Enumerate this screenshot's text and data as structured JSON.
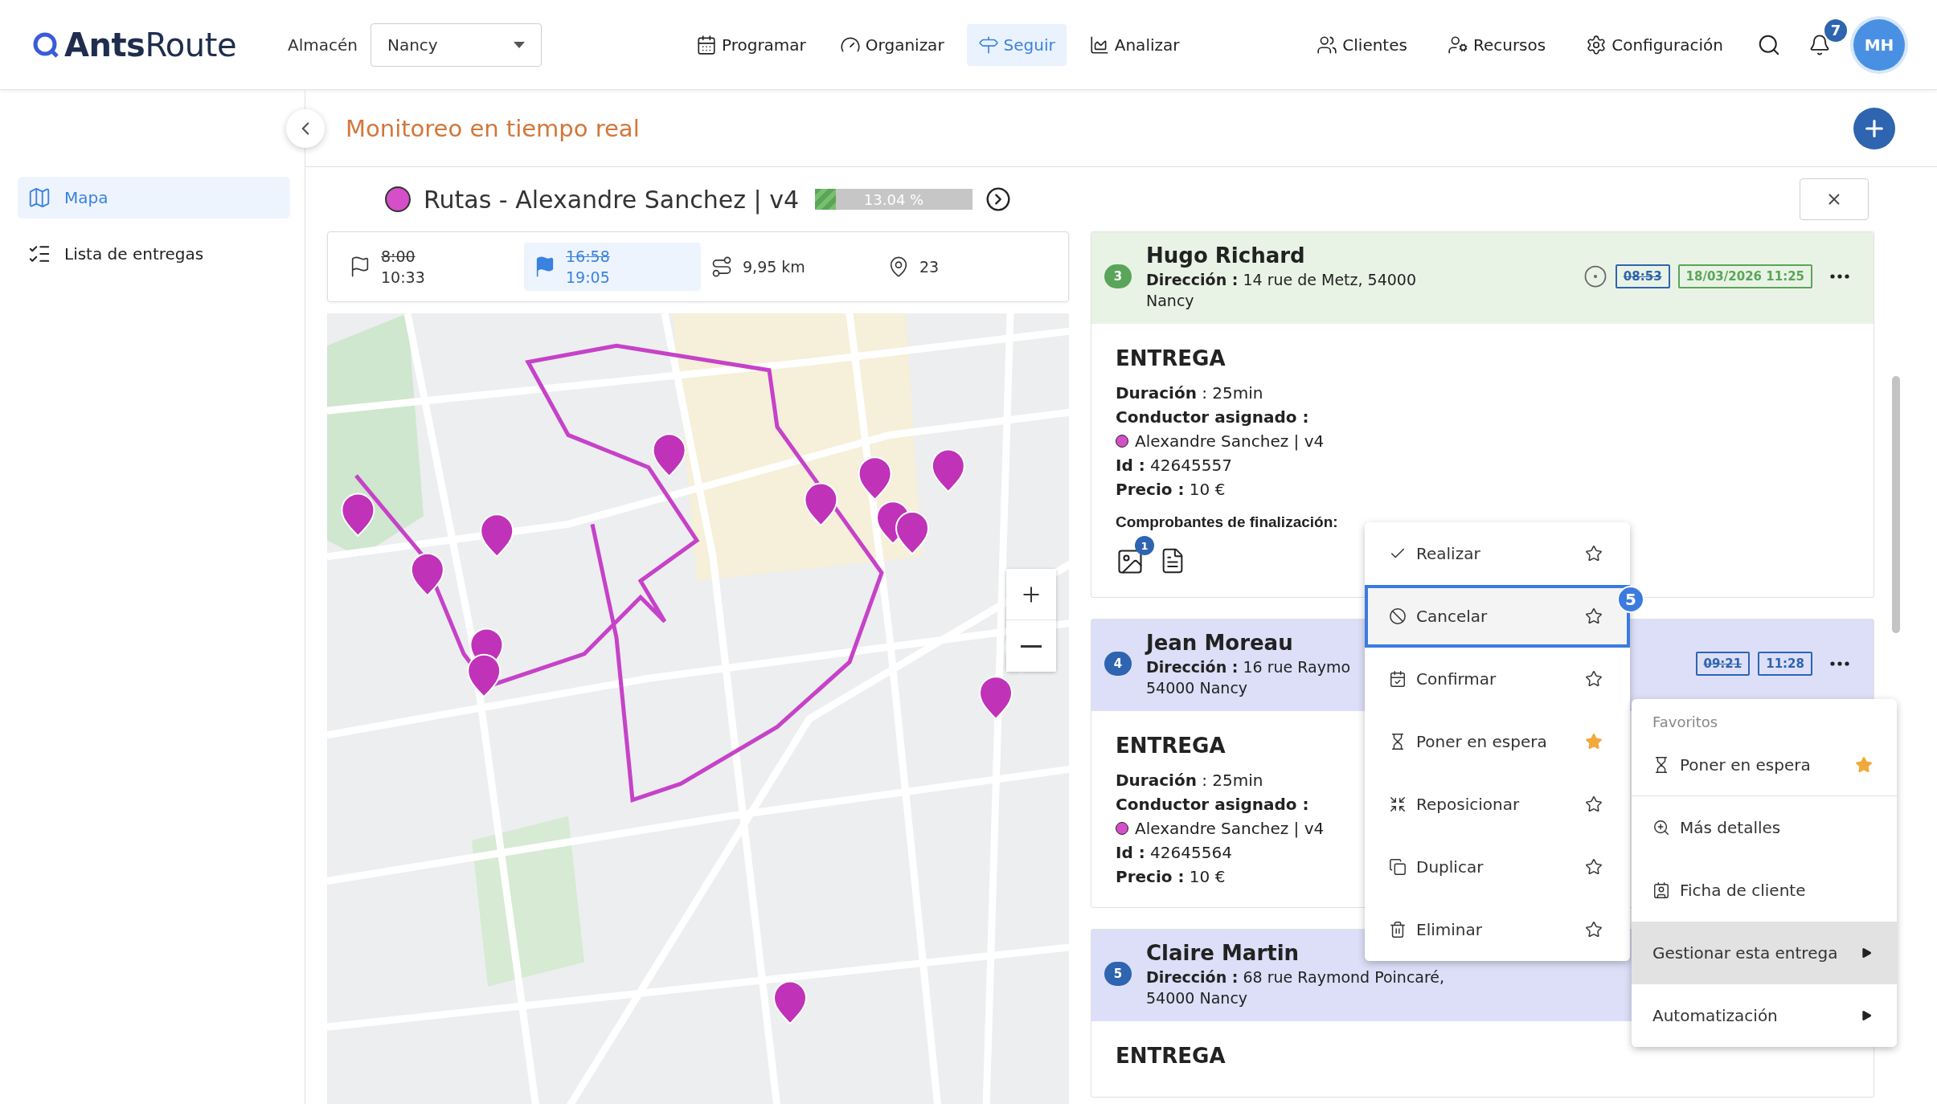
{
  "topbar": {
    "logo": {
      "bold": "Ants",
      "light": "Route"
    },
    "warehouse_label": "Almacén",
    "warehouse_select": {
      "value": "Nancy"
    },
    "nav": [
      {
        "label": "Programar",
        "selected": false
      },
      {
        "label": "Organizar",
        "selected": false
      },
      {
        "label": "Seguir",
        "selected": true
      },
      {
        "label": "Analizar",
        "selected": false
      }
    ],
    "right_nav": [
      {
        "label": "Clientes"
      },
      {
        "label": "Recursos"
      },
      {
        "label": "Configuración"
      }
    ],
    "notifications_count": "7",
    "avatar": "MH"
  },
  "sidebar": {
    "items": [
      {
        "label": "Mapa",
        "selected": true
      },
      {
        "label": "Lista de entregas",
        "selected": false
      }
    ]
  },
  "page_title": "Monitoreo en tiempo real",
  "route": {
    "color": "#d44fc8",
    "title": "Rutas - Alexandre Sanchez | v4",
    "progress": {
      "level": 0.1304,
      "label": "13.04 %"
    }
  },
  "summary": [
    {
      "kind": "start",
      "planned": "8:00",
      "actual": "10:33"
    },
    {
      "kind": "end",
      "planned": "16:58",
      "actual": "19:05",
      "highlighted": true
    },
    {
      "kind": "distance",
      "value": "9,95 km"
    },
    {
      "kind": "stops",
      "value": "23"
    }
  ],
  "deliveries": [
    {
      "number": "3",
      "kind": "completed",
      "name": "Hugo Richard",
      "address": [
        "**Dirección :** 14 rue de Metz, 54000",
        "Nancy"
      ],
      "locate": true,
      "planned_time": "08:53",
      "actual_time": "18/03/2026 11:25",
      "section": "ENTREGA",
      "details": [
        {
          "kind": "text",
          "text": "**Duración** : 25min"
        },
        {
          "kind": "heading",
          "text": "Conductor asignado :"
        },
        {
          "kind": "driver",
          "text": "Alexandre Sanchez | v4",
          "color": "#d44fc8"
        },
        {
          "kind": "text",
          "text": "**Id :** 42645557"
        },
        {
          "kind": "text",
          "text": "**Precio :** 10 €"
        }
      ],
      "proofs": {
        "label": "Comprobantes de finalización:",
        "photo_count": "1"
      }
    },
    {
      "number": "4",
      "kind": "pending",
      "name": "Jean Moreau",
      "address": [
        "**Dirección :** 16 rue Raymo",
        "54000 Nancy"
      ],
      "planned_time": "09:21",
      "actual_time": "11:28",
      "section": "ENTREGA",
      "details": [
        {
          "kind": "text",
          "text": "**Duración** : 25min"
        },
        {
          "kind": "heading",
          "text": "Conductor asignado :"
        },
        {
          "kind": "driver",
          "text": "Alexandre Sanchez | v4",
          "color": "#d44fc8"
        },
        {
          "kind": "text",
          "text": "**Id :** 42645564"
        },
        {
          "kind": "text",
          "text": "**Precio :** 10 €"
        }
      ]
    },
    {
      "number": "5",
      "kind": "pending",
      "name": "Claire Martin",
      "address": [
        "**Dirección :** 68 rue Raymond Poincaré,",
        "54000 Nancy"
      ],
      "section": "ENTREGA"
    }
  ],
  "action_menu": {
    "items": [
      {
        "label": "Realizar",
        "favorite": false,
        "selected": false
      },
      {
        "label": "Cancelar",
        "favorite": false,
        "selected": true,
        "step_badge": "5"
      },
      {
        "label": "Confirmar",
        "favorite": false,
        "selected": false
      },
      {
        "label": "Poner en espera",
        "favorite": true,
        "selected": false
      },
      {
        "label": "Reposicionar",
        "favorite": false,
        "selected": false
      },
      {
        "label": "Duplicar",
        "favorite": false,
        "selected": false
      },
      {
        "label": "Eliminar",
        "favorite": false,
        "selected": false
      }
    ]
  },
  "context_menu": {
    "favorites_label": "Favoritos",
    "favorites": [
      {
        "label": "Poner en espera",
        "favorite": true
      }
    ],
    "items": [
      {
        "label": "Más detalles",
        "selected": false
      },
      {
        "label": "Ficha de cliente",
        "selected": false
      },
      {
        "label": "Gestionar esta entrega",
        "selected": true,
        "submenu": true
      },
      {
        "label": "Automatización",
        "selected": false,
        "submenu": true
      }
    ]
  }
}
